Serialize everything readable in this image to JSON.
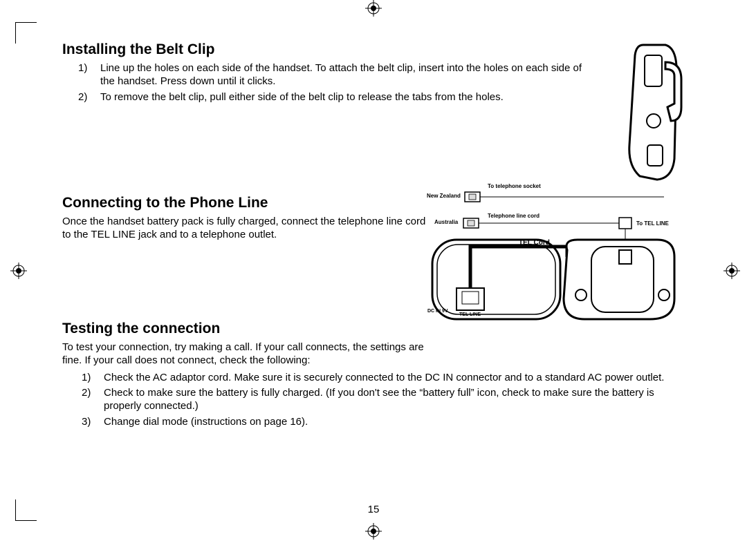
{
  "page_number": "15",
  "section1": {
    "heading": "Installing the Belt Clip",
    "step1": "Line up the holes on each side of the handset. To attach the belt clip, insert into the holes on each side of the handset. Press down until it clicks.",
    "step2": "To remove the belt clip, pull either side of the belt clip to release the tabs from the holes."
  },
  "section2": {
    "heading": "Connecting to the Phone Line",
    "body": "Once the handset battery pack is fully charged, connect the telephone line cord to the TEL LINE jack and to a telephone outlet.",
    "labels": {
      "nz": "New Zealand",
      "au": "Australia",
      "socket": "To telephone socket",
      "line_cord": "Telephone line cord",
      "to_tel_line": "To TEL LINE",
      "tel_cord": "TEL Cord",
      "dc_in": "DC IN 9V",
      "tel_line": "TEL LINE"
    }
  },
  "section3": {
    "heading": "Testing the connection",
    "body": "To test your connection, try making a call. If your call connects, the settings are fine. If your call does not connect, check the following:",
    "step1": "Check the AC adaptor cord. Make sure it is securely connected to the DC IN connector and to a standard AC power outlet.",
    "step2": "Check to make sure the battery is fully charged. (If you don't see the “battery full” icon, check to make sure the battery is properly connected.)",
    "step3": "Change dial mode (instructions on page 16)."
  }
}
